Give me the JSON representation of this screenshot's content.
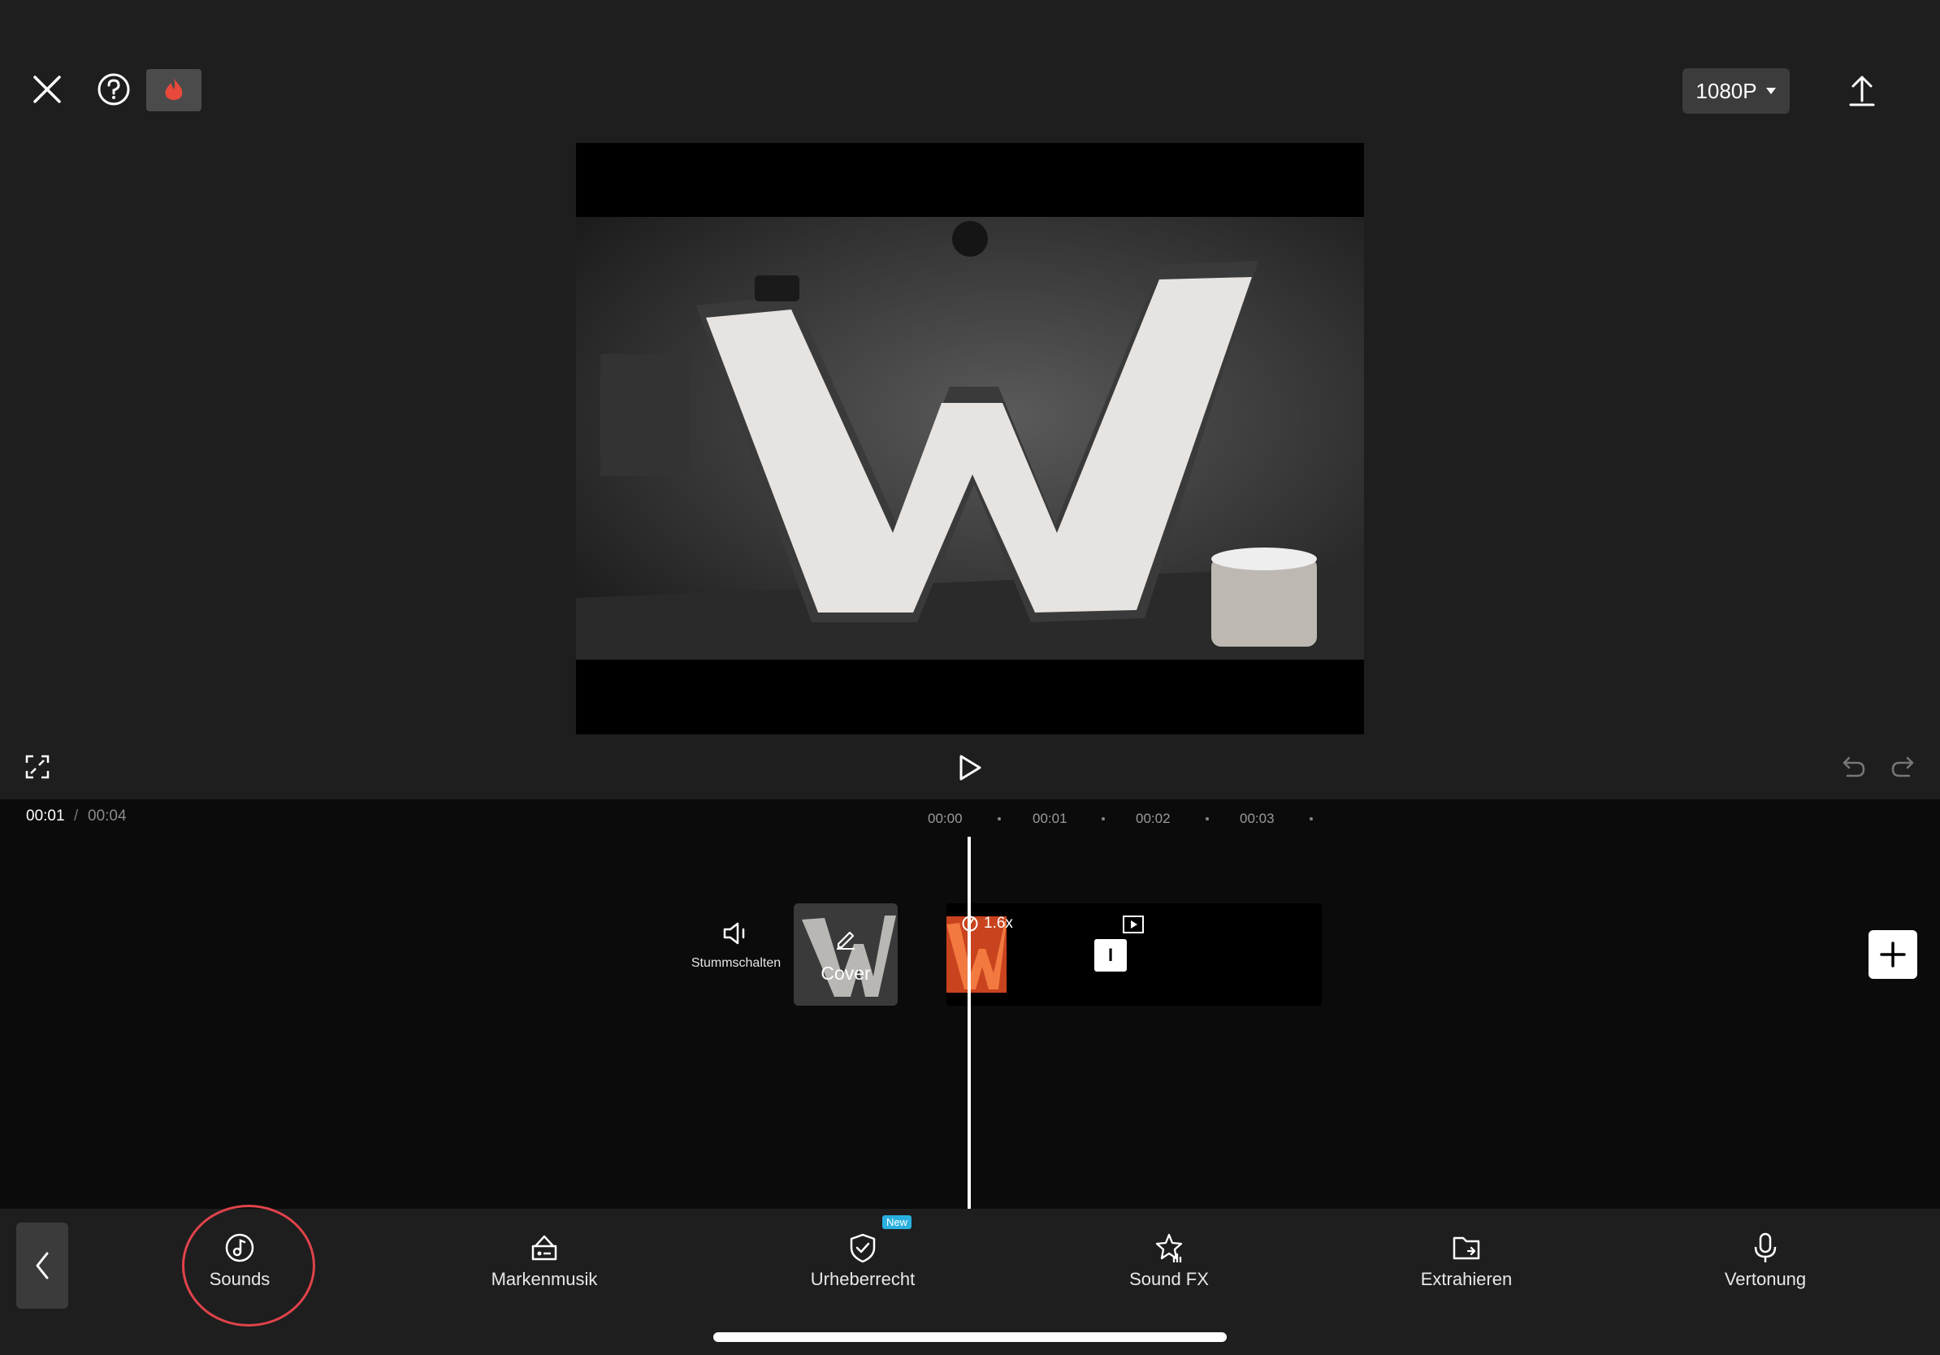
{
  "topbar": {
    "resolution": "1080P",
    "icons": [
      "close-icon",
      "help-icon",
      "flame-icon",
      "export-icon"
    ]
  },
  "preview": {
    "icons": [
      "fullscreen-icon",
      "play-icon",
      "undo-icon",
      "redo-icon"
    ]
  },
  "timeline": {
    "current_time": "00:01",
    "separator": "/",
    "total_time": "00:04",
    "ticks": [
      "00:00",
      "00:01",
      "00:02",
      "00:03"
    ],
    "mute_label": "Stummschalten",
    "cover_label": "Cover",
    "clip_speed": "1.6x",
    "transition_glyph": "I"
  },
  "toolbar": {
    "items": [
      {
        "label": "Sounds",
        "icon": "music-note-icon"
      },
      {
        "label": "Markenmusik",
        "icon": "brand-music-icon"
      },
      {
        "label": "Urheberrecht",
        "icon": "copyright-shield-icon",
        "badge": "New"
      },
      {
        "label": "Sound FX",
        "icon": "sound-fx-icon"
      },
      {
        "label": "Extrahieren",
        "icon": "extract-folder-icon"
      },
      {
        "label": "Vertonung",
        "icon": "microphone-icon"
      }
    ]
  },
  "colors": {
    "background": "#1e1e1e",
    "timeline_bg": "#0b0b0b",
    "highlight_ring": "#e0434b",
    "flame": "#e8493a",
    "new_badge": "#2ab0e0",
    "clip_thumb": "#c8431e"
  }
}
